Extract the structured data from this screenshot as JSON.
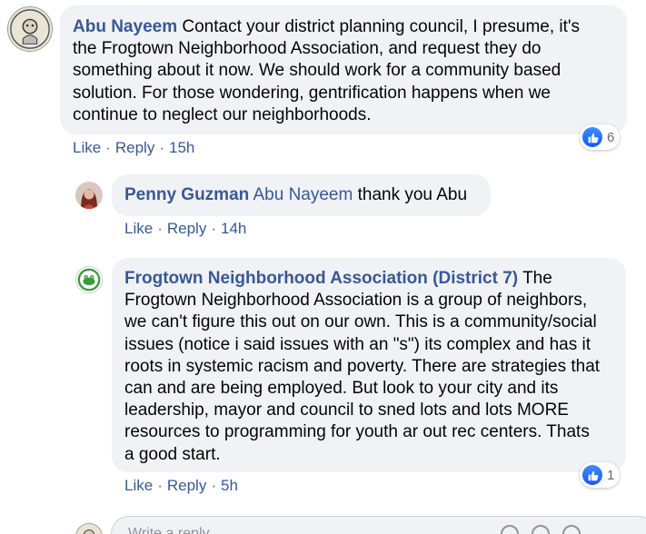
{
  "comments": [
    {
      "author": "Abu Nayeem",
      "lines": [
        "Contact your district planning council, I presume, it's",
        "the Frogtown Neighborhood Association, and request they do",
        "something about it now. We should work for a community based",
        "solution. For those wondering, gentrification happens when we",
        "continue to neglect our neighborhoods."
      ],
      "actions": {
        "like": "Like",
        "reply": "Reply",
        "time": "15h"
      },
      "reactions": {
        "icon": "like-icon",
        "count": "6"
      }
    },
    {
      "author": "Penny Guzman",
      "mention": "Abu Nayeem",
      "text": "thank you Abu",
      "actions": {
        "like": "Like",
        "reply": "Reply",
        "time": "14h"
      }
    },
    {
      "author": "Frogtown Neighborhood Association (District 7)",
      "first_line": "The",
      "lines": [
        "Frogtown Neighborhood Association is a group of neighbors,",
        "we can't figure this out on our own. This is a community/social",
        "issues (notice i said issues with an \"s\") its complex and has it",
        "roots in systemic racism and poverty. There are strategies that",
        "can and are being employed. But look to your city and its",
        "leadership, mayor and council to sned lots and lots MORE",
        "resources to programming for youth ar out rec centers. Thats",
        "a good start."
      ],
      "actions": {
        "like": "Like",
        "reply": "Reply",
        "time": "5h"
      },
      "reactions": {
        "icon": "like-icon",
        "count": "1"
      }
    }
  ],
  "reply_box": {
    "placeholder": "Write a reply..."
  },
  "separator": "·",
  "colors": {
    "link": "#385898",
    "bubble": "#f0f2f5",
    "like_blue": "#1877f2",
    "frog_green": "#3a9b3a"
  }
}
